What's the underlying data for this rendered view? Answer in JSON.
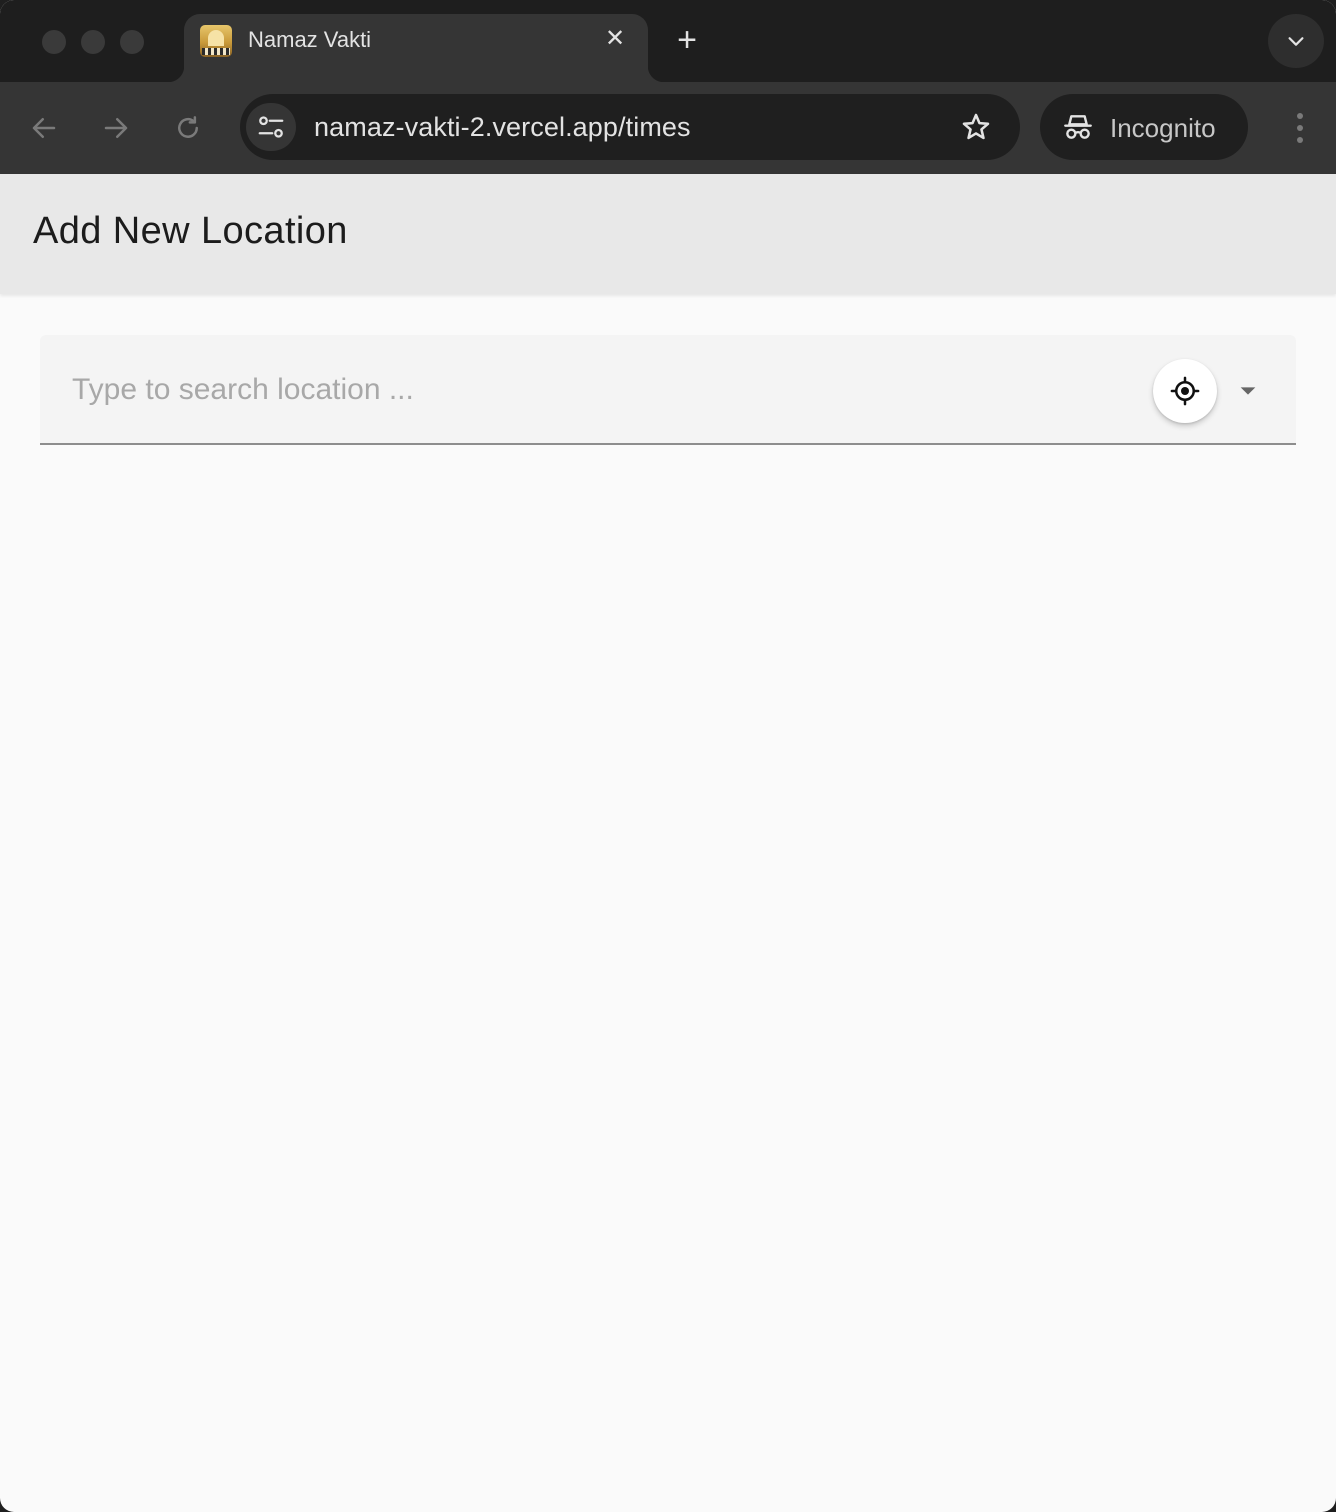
{
  "browser": {
    "tab": {
      "title": "Namaz Vakti",
      "close_glyph": "✕",
      "favicon": "mosque-favicon-icon"
    },
    "new_tab_glyph": "+",
    "address_bar": {
      "url": "namaz-vakti-2.vercel.app/times"
    },
    "incognito_label": "Incognito",
    "colors": {
      "frame": "#1e1e1e",
      "toolbar": "#353535",
      "omnibox": "#1f1f1f"
    }
  },
  "page": {
    "title": "Add New Location",
    "search": {
      "placeholder": "Type to search location ...",
      "value": ""
    },
    "icons": {
      "locate": "my-location-icon",
      "dropdown": "arrow-drop-down-icon"
    },
    "colors": {
      "header_bg": "#e8e8e8",
      "page_bg": "#fafafa",
      "field_bg": "#f4f4f4"
    }
  }
}
